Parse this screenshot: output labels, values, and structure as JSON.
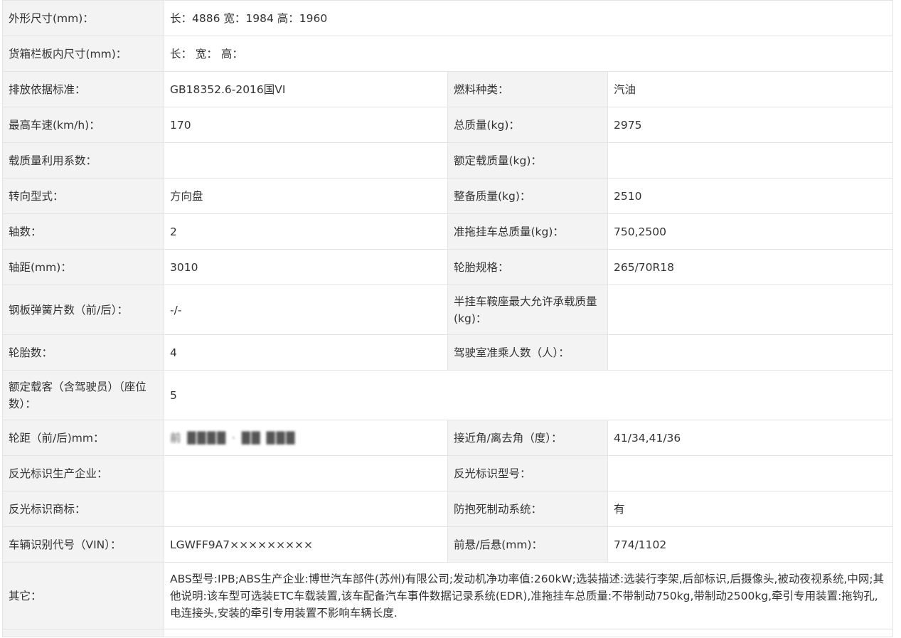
{
  "rows": [
    {
      "type": "wide",
      "label": "外形尺寸(mm)：",
      "value": "长：4886 宽：1984 高：1960"
    },
    {
      "type": "wide",
      "label": "货箱栏板内尺寸(mm)：",
      "value": "长： 宽： 高："
    },
    {
      "type": "pair",
      "label1": "排放依据标准：",
      "value1": "GB18352.6-2016国VI",
      "label2": "燃料种类：",
      "value2": "汽油"
    },
    {
      "type": "pair",
      "label1": "最高车速(km/h)：",
      "value1": "170",
      "label2": "总质量(kg)：",
      "value2": "2975"
    },
    {
      "type": "pair",
      "label1": "载质量利用系数：",
      "value1": "",
      "label2": "额定载质量(kg)：",
      "value2": ""
    },
    {
      "type": "pair",
      "label1": "转向型式：",
      "value1": "方向盘",
      "label2": "整备质量(kg)：",
      "value2": "2510"
    },
    {
      "type": "pair",
      "label1": "轴数：",
      "value1": "2",
      "label2": "准拖挂车总质量(kg)：",
      "value2": "750,2500"
    },
    {
      "type": "pair",
      "label1": "轴距(mm)：",
      "value1": "3010",
      "label2": "轮胎规格：",
      "value2": "265/70R18"
    },
    {
      "type": "pair",
      "label1": "钢板弹簧片数（前/后）：",
      "value1": "-/-",
      "label2": "半挂车鞍座最大允许承载质量(kg)：",
      "value2": ""
    },
    {
      "type": "pair",
      "label1": "轮胎数：",
      "value1": "4",
      "label2": "驾驶室准乘人数（人）：",
      "value2": ""
    },
    {
      "type": "wide",
      "label": "额定载客（含驾驶员）（座位数）：",
      "value": "5"
    },
    {
      "type": "pair",
      "label1": "轮距（前/后)mm：",
      "value1": "前 ████ · ██ ███",
      "label2": "接近角/离去角（度）：",
      "value2": "41/34,41/36"
    },
    {
      "type": "pair",
      "label1": "反光标识生产企业：",
      "value1": "",
      "label2": "反光标识型号：",
      "value2": ""
    },
    {
      "type": "pair",
      "label1": "反光标识商标：",
      "value1": "",
      "label2": "防抱死制动系统：",
      "value2": "有"
    },
    {
      "type": "pair",
      "label1": "车辆识别代号（VIN）：",
      "value1": "LGWFF9A7×××××××××",
      "label2": "前悬/后悬(mm)：",
      "value2": "774/1102"
    },
    {
      "type": "wide",
      "label": "其它：",
      "value": "ABS型号:IPB;ABS生产企业:博世汽车部件(苏州)有限公司;发动机净功率值:260kW;选装描述:选装行李架,后部标识,后摄像头,被动夜视系统,中网;其他说明:该车型可选装ETC车载装置,该车配备汽车事件数据记录系统(EDR),准拖挂车总质量:不带制动750kg,带制动2500kg,牵引专用装置:拖钩孔,电连接头,安装的牵引专用装置不影响车辆长度."
    }
  ]
}
